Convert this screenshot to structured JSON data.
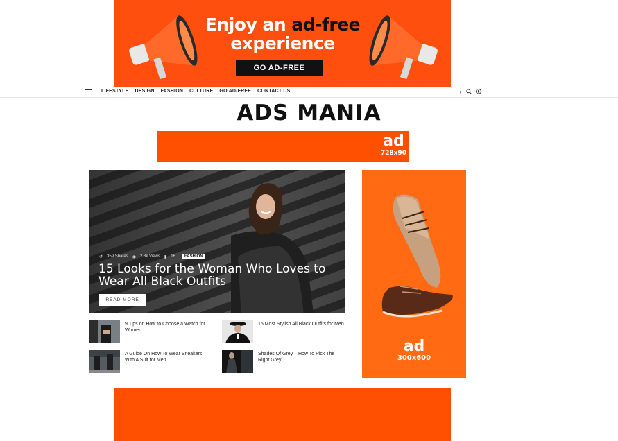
{
  "top_banner": {
    "headline_line1_prefix": "Enjoy an ",
    "headline_line1_highlight": "ad-free",
    "headline_line2": "experience",
    "cta_label": "GO AD-FREE",
    "background_color": "#ff4f0f"
  },
  "nav": {
    "items": [
      "LIFESTYLE",
      "DESIGN",
      "FASHION",
      "CULTURE",
      "GO AD-FREE",
      "CONTACT US"
    ],
    "icons": [
      "menu-icon",
      "dark-mode-icon",
      "search-icon",
      "user-icon"
    ]
  },
  "logo": {
    "text": "ADS MANIA"
  },
  "leaderboard_ad": {
    "label": "ad",
    "size": "728x90",
    "color": "#ff4f00"
  },
  "hero": {
    "shares": "359 Shares",
    "views": "2.8k Views",
    "comments": "16",
    "category": "FASHION",
    "title": "15 Looks for the Woman Who Loves to Wear All Black Outfits",
    "read_more": "READ MORE"
  },
  "posts": [
    {
      "title": "9 Tips on How to Choose a Watch for Women"
    },
    {
      "title": "15 Most Stylish All Black Outfits for Men"
    },
    {
      "title": "A Guide On How To Wear Sneakers With A Suit for Men"
    },
    {
      "title": "Shades Of Grey – How To Pick The Right Grey"
    }
  ],
  "side_ad": {
    "label": "ad",
    "size": "300x600",
    "color": "#ff6a12"
  },
  "bottom_ad": {
    "color": "#ff4f00"
  }
}
